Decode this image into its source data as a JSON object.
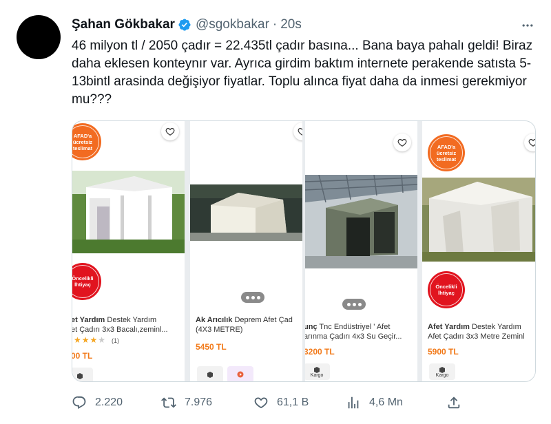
{
  "tweet": {
    "author_name": "Şahan Gökbakar",
    "handle": "@sgokbakar",
    "separator": "·",
    "time": "20s",
    "text": "46 milyon tl / 2050 çadır = 22.435tl çadır basına... Bana baya pahalı geldi! Biraz daha eklesen konteynır var. Ayrıca girdim baktım internete perakende satısta 5-13bintl arasinda değişiyor fiyatlar. Toplu alınca fiyat daha da inmesi gerekmiyor mu???"
  },
  "media": {
    "products": [
      {
        "badge_top": [
          "AFAD'a",
          "ücretsiz",
          "teslimat"
        ],
        "badge_bottom": [
          "Öncelikli",
          "İhtiyaç"
        ],
        "brand": "et Yardım",
        "name_1": "Destek Yardım",
        "name_2": "et Çadırı 3x3 Bacalı,zeminl...",
        "rating_count": "(1)",
        "price": "00 TL"
      },
      {
        "brand": "Ak Arıcılık",
        "name_1": "Deprem Afet Çad",
        "name_2": "(4X3 METRE)",
        "price": "5450 TL"
      },
      {
        "brand": "unç",
        "name_1": "Tnc Endüstriyel ' Afet",
        "name_2": "arınma Çadırı 4x3 Su Geçir...",
        "price": "3200 TL",
        "chip_label": "Kargo"
      },
      {
        "badge_top": [
          "AFAD'a",
          "ücretsiz",
          "teslimat"
        ],
        "badge_bottom": [
          "Öncelikli",
          "İhtiyaç"
        ],
        "brand": "Afet Yardım",
        "name_1": "Destek Yardım",
        "name_2": "Afet Çadırı 3x3 Metre Zeminl",
        "price": "5900 TL",
        "chip_label": "Kargo"
      }
    ]
  },
  "actions": {
    "replies": "2.220",
    "retweets": "7.976",
    "likes": "61,1 B",
    "views": "4,6 Mn"
  },
  "colors": {
    "verified": "#1d9bf0",
    "muted": "#536471",
    "price": "#f27a1a",
    "badge_orange": "#f26b21",
    "badge_red": "#e1141f"
  },
  "icons": [
    "verified-badge-icon",
    "more-icon",
    "heart-icon",
    "reply-icon",
    "retweet-icon",
    "like-icon",
    "views-icon",
    "share-icon",
    "box-icon",
    "play-icon"
  ]
}
